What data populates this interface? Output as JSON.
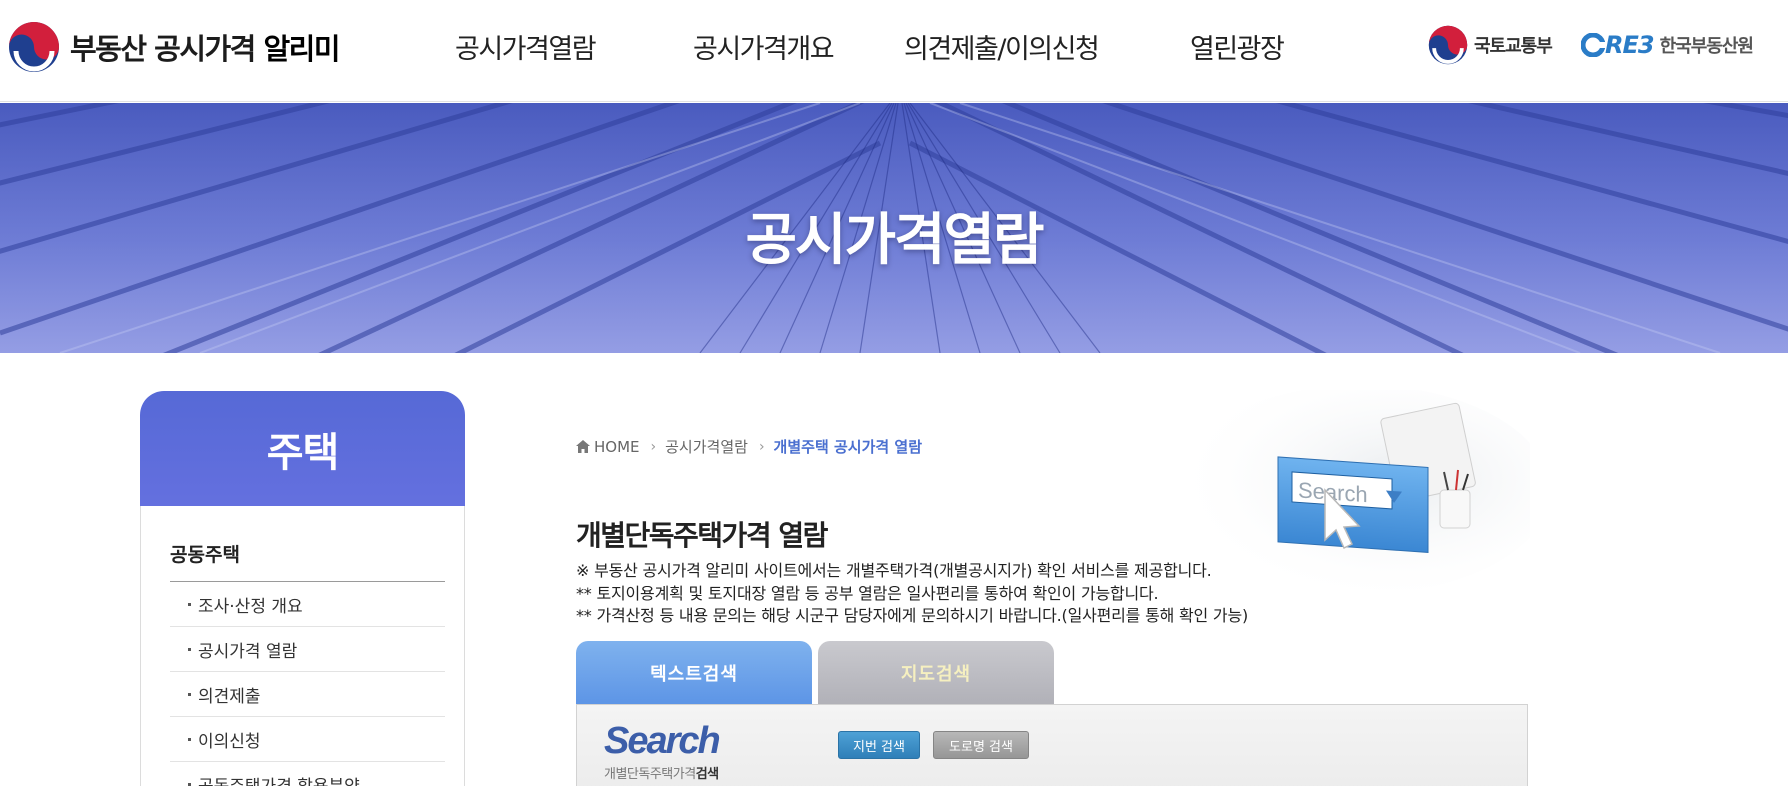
{
  "header": {
    "logo_text_regular": "부동산 공시가격 ",
    "logo_text_bold": "알리미",
    "nav": [
      {
        "label": "공시가격열람"
      },
      {
        "label": "공시가격개요"
      },
      {
        "label": "의견제출/이의신청"
      },
      {
        "label": "열린광장"
      }
    ],
    "partners": {
      "molit": "국토교통부",
      "reb_mark": "RE3",
      "reb_name": "한국부동산원"
    }
  },
  "banner": {
    "title": "공시가격열람"
  },
  "sidebar": {
    "title": "주택",
    "group_title": "공동주택",
    "items": [
      {
        "label": "조사·산정 개요"
      },
      {
        "label": "공시가격 열람"
      },
      {
        "label": "의견제출"
      },
      {
        "label": "이의신청"
      },
      {
        "label": "공동주택가격 할용분양"
      }
    ]
  },
  "breadcrumb": {
    "home": "HOME",
    "level1": "공시가격열람",
    "current": "개별주택 공시가격 열람"
  },
  "main": {
    "title": "개별단독주택가격 열람",
    "notes": [
      "※ 부동산 공시가격 알리미 사이트에서는 개별주택가격(개별공시지가) 확인 서비스를 제공합니다.",
      "** 토지이용계획 및 토지대장 열람 등 공부 열람은 일사편리를 통하여 확인이 가능합니다.",
      "** 가격산정 등 내용 문의는 해당 시군구 담당자에게 문의하시기 바랍니다.(일사편리를 통해 확인 가능)"
    ],
    "illustration_text": "Search",
    "tabs": [
      {
        "label": "텍스트검색",
        "active": true
      },
      {
        "label": "지도검색",
        "active": false
      }
    ],
    "search_panel": {
      "logo_big": "Search",
      "logo_small_regular": "개별단독주택가격",
      "logo_small_bold": "검색",
      "buttons": [
        {
          "label": "지번 검색"
        },
        {
          "label": "도로명 검색"
        }
      ]
    }
  },
  "colors": {
    "accent_blue": "#5669d6",
    "tab_active": "#6a9fe9",
    "tab_inactive": "#bdbdc3",
    "breadcrumb_current": "#4a6fd0",
    "button_primary": "#3c8ec8",
    "button_secondary": "#a0a0a0"
  }
}
